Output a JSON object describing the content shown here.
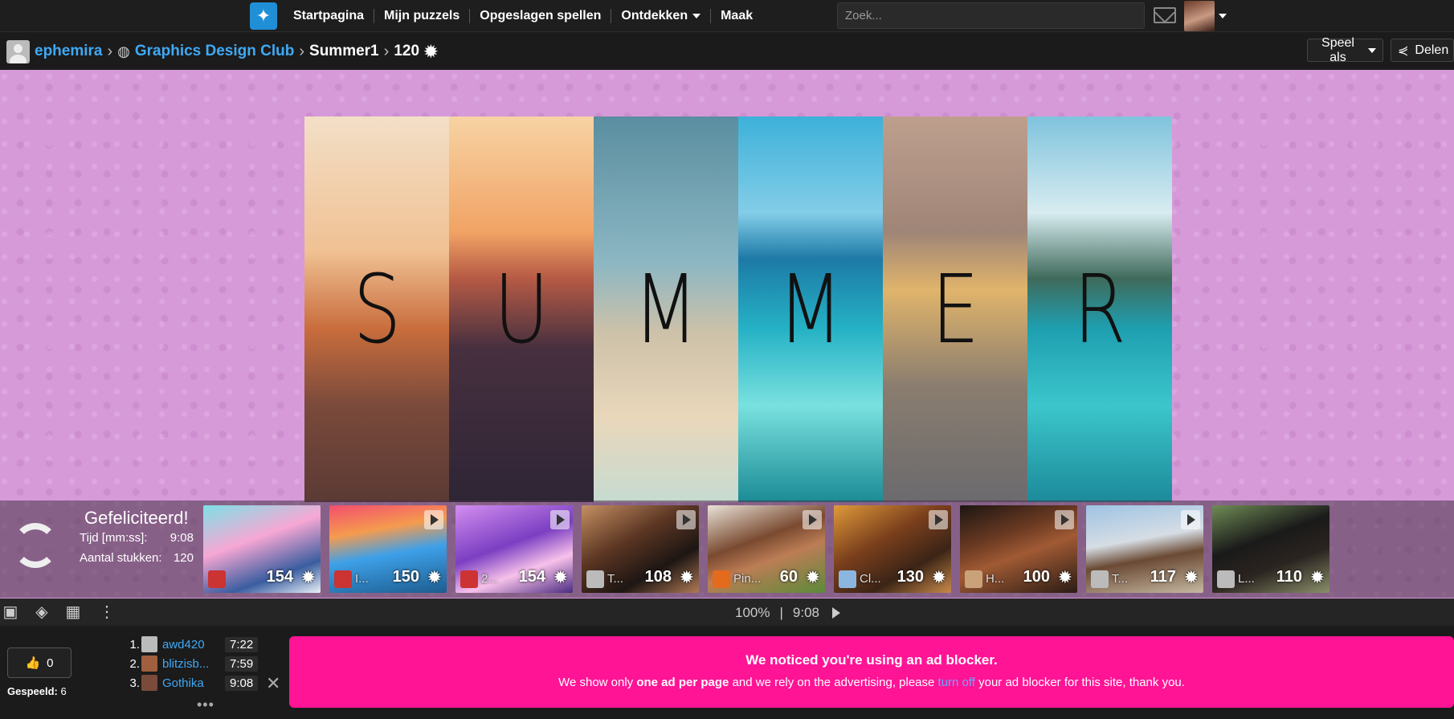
{
  "nav": {
    "items": [
      "Startpagina",
      "Mijn puzzels",
      "Opgeslagen spellen",
      "Ontdekken",
      "Maak"
    ],
    "search_placeholder": "Zoek..."
  },
  "breadcrumb": {
    "user": "ephemira",
    "club": "Graphics Design Club",
    "puzzle": "Summer1",
    "pieces": "120"
  },
  "actions": {
    "play_as": "Speel als",
    "share": "Delen"
  },
  "puzzle": {
    "letters": [
      "S",
      "U",
      "M",
      "M",
      "E",
      "R"
    ]
  },
  "result": {
    "title": "Gefeliciteerd!",
    "time_label": "Tijd [mm:ss]:",
    "time_value": "9:08",
    "pieces_label": "Aantal stukken:",
    "pieces_value": "120"
  },
  "thumbs": [
    {
      "count": "154",
      "label": ""
    },
    {
      "count": "150",
      "label": "I..."
    },
    {
      "count": "154",
      "label": "2..."
    },
    {
      "count": "108",
      "label": "T..."
    },
    {
      "count": "60",
      "label": "Pin..."
    },
    {
      "count": "130",
      "label": "Cl..."
    },
    {
      "count": "100",
      "label": "H..."
    },
    {
      "count": "117",
      "label": "T..."
    },
    {
      "count": "110",
      "label": "L..."
    }
  ],
  "toolbar": {
    "zoom": "100%",
    "separator": "|",
    "timer": "9:08"
  },
  "likes": {
    "count": "0",
    "played_label": "Gespeeld:",
    "played_value": "6"
  },
  "leaderboard": [
    {
      "rank": "1.",
      "name": "awd420",
      "time": "7:22"
    },
    {
      "rank": "2.",
      "name": "blitzisb...",
      "time": "7:59"
    },
    {
      "rank": "3.",
      "name": "Gothika",
      "time": "9:08"
    }
  ],
  "ad": {
    "title": "We noticed you're using an ad blocker.",
    "text_1": "We show only ",
    "text_bold": "one ad per page",
    "text_2": " and we rely on the advertising, please ",
    "link": "turn off",
    "text_3": " your ad blocker for this site, thank you."
  },
  "colors": {
    "link": "#3fa9f5",
    "ad_bg": "#ff1495",
    "stage_bg": "#d79ad9"
  }
}
